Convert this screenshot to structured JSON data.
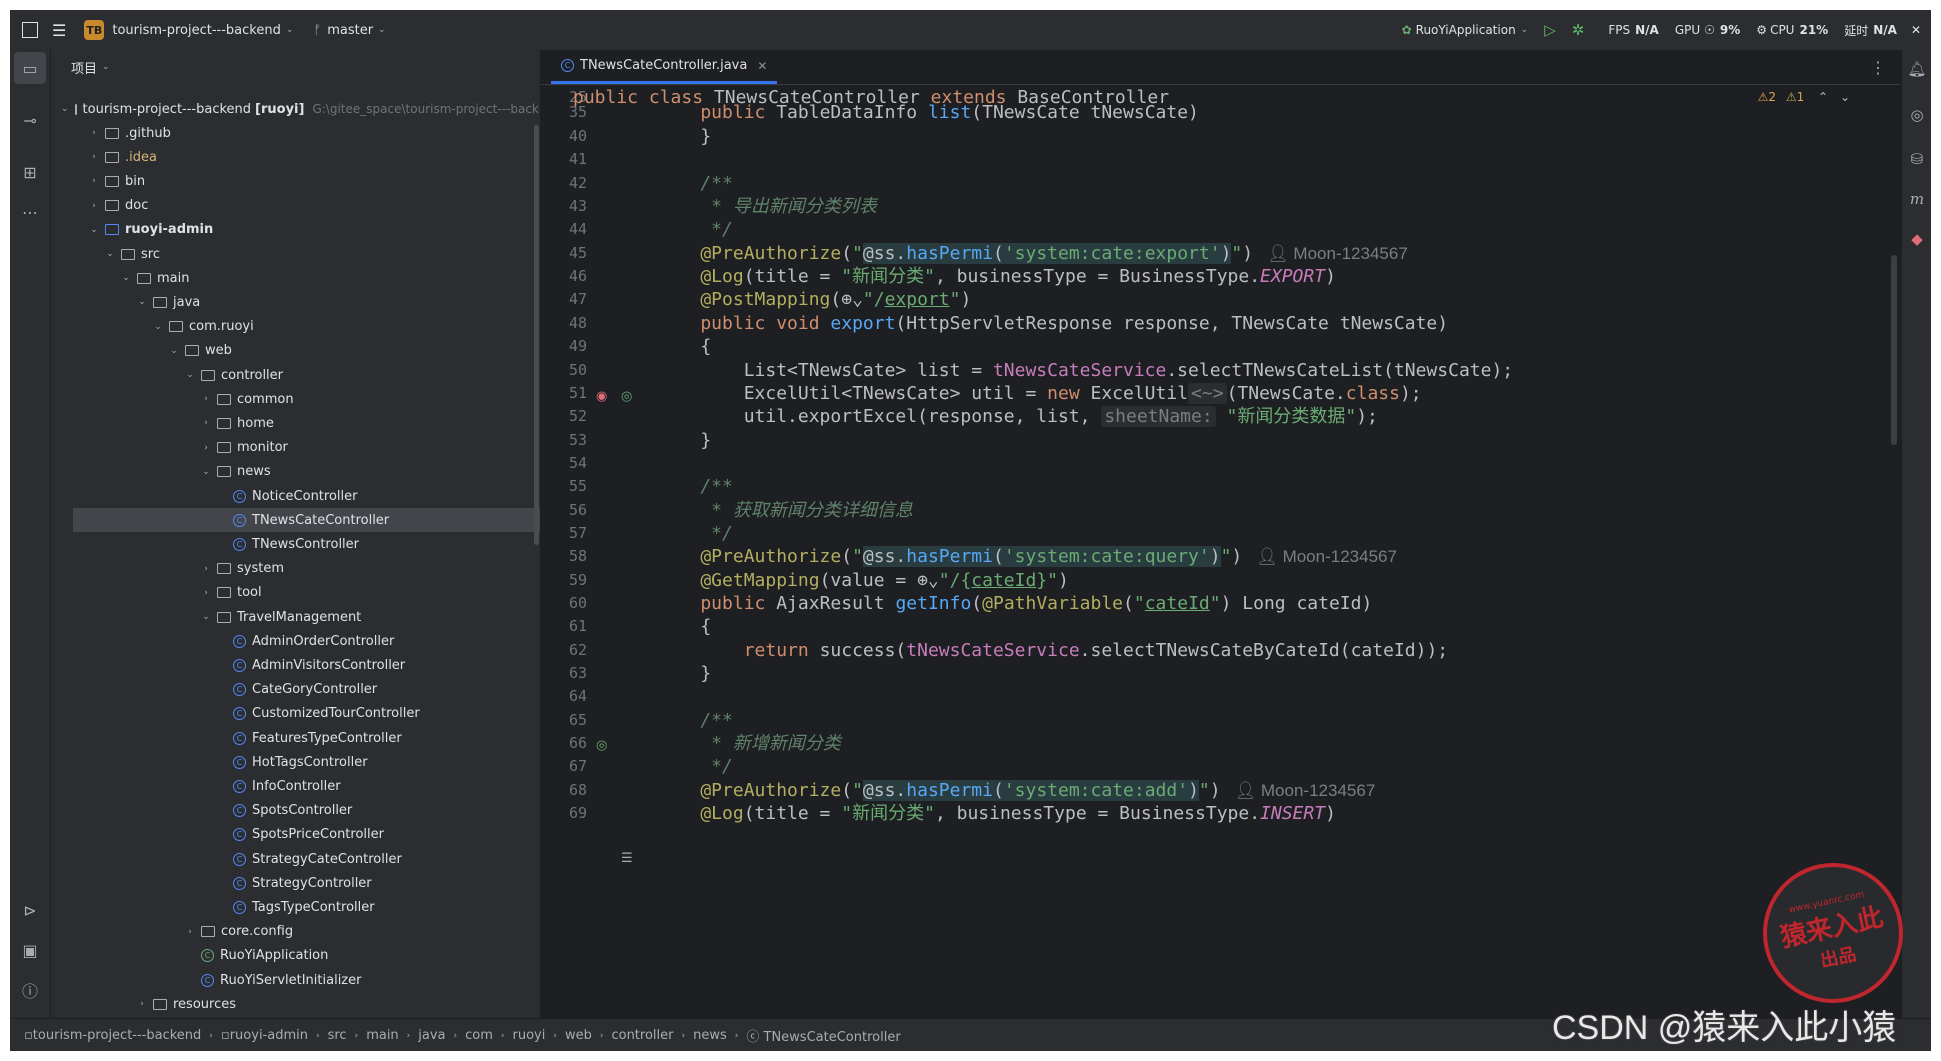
{
  "titlebar": {
    "project_badge": "TB",
    "project_name": "tourism-project---backend",
    "branch": "master",
    "run_config": "RuoYiApplication",
    "fps_label": "FPS",
    "fps_value": "N/A",
    "gpu_label": "GPU",
    "gpu_value": "9%",
    "cpu_label": "CPU",
    "cpu_value": "21%",
    "time_label": "延时",
    "time_value": "N/A"
  },
  "project_panel": {
    "header": "项目",
    "root_name": "tourism-project---backend",
    "root_module": "[ruoyi]",
    "root_path": "G:\\gitee_space\\tourism-project---back",
    "tree": [
      {
        "label": ".github",
        "depth": 1,
        "kind": "folder",
        "state": "collapsed"
      },
      {
        "label": ".idea",
        "depth": 1,
        "kind": "folder",
        "state": "collapsed",
        "style": "yellow"
      },
      {
        "label": "bin",
        "depth": 1,
        "kind": "folder",
        "state": "collapsed"
      },
      {
        "label": "doc",
        "depth": 1,
        "kind": "folder",
        "state": "collapsed"
      },
      {
        "label": "ruoyi-admin",
        "depth": 1,
        "kind": "module",
        "state": "expanded",
        "style": "bold"
      },
      {
        "label": "src",
        "depth": 2,
        "kind": "folder",
        "state": "expanded"
      },
      {
        "label": "main",
        "depth": 3,
        "kind": "folder",
        "state": "expanded"
      },
      {
        "label": "java",
        "depth": 4,
        "kind": "folder",
        "state": "expanded"
      },
      {
        "label": "com.ruoyi",
        "depth": 5,
        "kind": "package",
        "state": "expanded"
      },
      {
        "label": "web",
        "depth": 6,
        "kind": "package",
        "state": "expanded"
      },
      {
        "label": "controller",
        "depth": 7,
        "kind": "package",
        "state": "expanded"
      },
      {
        "label": "common",
        "depth": 8,
        "kind": "package",
        "state": "collapsed"
      },
      {
        "label": "home",
        "depth": 8,
        "kind": "package",
        "state": "collapsed"
      },
      {
        "label": "monitor",
        "depth": 8,
        "kind": "package",
        "state": "collapsed"
      },
      {
        "label": "news",
        "depth": 8,
        "kind": "package",
        "state": "expanded"
      },
      {
        "label": "NoticeController",
        "depth": 9,
        "kind": "class"
      },
      {
        "label": "TNewsCateController",
        "depth": 9,
        "kind": "class",
        "selected": true
      },
      {
        "label": "TNewsController",
        "depth": 9,
        "kind": "class"
      },
      {
        "label": "system",
        "depth": 8,
        "kind": "package",
        "state": "collapsed"
      },
      {
        "label": "tool",
        "depth": 8,
        "kind": "package",
        "state": "collapsed"
      },
      {
        "label": "TravelManagement",
        "depth": 8,
        "kind": "package",
        "state": "expanded"
      },
      {
        "label": "AdminOrderController",
        "depth": 9,
        "kind": "class"
      },
      {
        "label": "AdminVisitorsController",
        "depth": 9,
        "kind": "class"
      },
      {
        "label": "CateGoryController",
        "depth": 9,
        "kind": "class"
      },
      {
        "label": "CustomizedTourController",
        "depth": 9,
        "kind": "class"
      },
      {
        "label": "FeaturesTypeController",
        "depth": 9,
        "kind": "class"
      },
      {
        "label": "HotTagsController",
        "depth": 9,
        "kind": "class"
      },
      {
        "label": "InfoController",
        "depth": 9,
        "kind": "class"
      },
      {
        "label": "SpotsController",
        "depth": 9,
        "kind": "class"
      },
      {
        "label": "SpotsPriceController",
        "depth": 9,
        "kind": "class"
      },
      {
        "label": "StrategyCateController",
        "depth": 9,
        "kind": "class"
      },
      {
        "label": "StrategyController",
        "depth": 9,
        "kind": "class"
      },
      {
        "label": "TagsTypeController",
        "depth": 9,
        "kind": "class"
      },
      {
        "label": "core.config",
        "depth": 7,
        "kind": "package",
        "state": "collapsed"
      },
      {
        "label": "RuoYiApplication",
        "depth": 7,
        "kind": "app"
      },
      {
        "label": "RuoYiServletInitializer",
        "depth": 7,
        "kind": "class"
      },
      {
        "label": "resources",
        "depth": 4,
        "kind": "folder",
        "state": "collapsed"
      }
    ]
  },
  "editor": {
    "tab_label": "TNewsCateController.java",
    "warnings": "⚠2",
    "weak_warnings": "⚠1",
    "line_numbers": [
      "25",
      "35",
      "40",
      "41",
      "42",
      "43",
      "44",
      "45",
      "46",
      "47",
      "48",
      "49",
      "50",
      "51",
      "52",
      "53",
      "54",
      "55",
      "56",
      "57",
      "58",
      "59",
      "60",
      "61",
      "62",
      "63",
      "64",
      "65",
      "66",
      "67",
      "68",
      "69"
    ],
    "lines": [
      [
        [
          "kw",
          "public class "
        ],
        [
          "",
          "TNewsCateController "
        ],
        [
          "kw",
          "extends "
        ],
        [
          "",
          "BaseController"
        ]
      ],
      [
        [
          "kw",
          "    public "
        ],
        [
          "",
          "TableDataInfo "
        ],
        [
          "fn",
          "list"
        ],
        [
          "",
          "(TNewsCate tNewsCate)"
        ]
      ],
      [
        [
          "",
          "    }"
        ]
      ],
      [
        [
          "",
          ""
        ]
      ],
      [
        [
          "doc",
          "    /**"
        ]
      ],
      [
        [
          "doc",
          "     * 导出新闻分类列表"
        ]
      ],
      [
        [
          "doc",
          "     */"
        ]
      ],
      [
        [
          "ann",
          "    @PreAuthorize"
        ],
        [
          "",
          "("
        ],
        [
          "str",
          "\""
        ],
        [
          "inj",
          "@ss."
        ],
        [
          "fn inj",
          "hasPermi"
        ],
        [
          "inj",
          "("
        ],
        [
          "str inj",
          "'system:cate:export'"
        ],
        [
          "inj",
          ")"
        ],
        [
          "str",
          "\""
        ],
        [
          "",
          ")"
        ],
        [
          "author",
          "Moon-1234567"
        ]
      ],
      [
        [
          "ann",
          "    @Log"
        ],
        [
          "",
          "(title = "
        ],
        [
          "str",
          "\"新闻分类\""
        ],
        [
          "",
          ", businessType = BusinessType."
        ],
        [
          "itl",
          "EXPORT"
        ],
        [
          "",
          ")"
        ]
      ],
      [
        [
          "ann",
          "    @PostMapping"
        ],
        [
          "",
          "(⊕⌄"
        ],
        [
          "str",
          "\"/"
        ],
        [
          "str underline",
          "export"
        ],
        [
          "str",
          "\""
        ],
        [
          "",
          ")"
        ]
      ],
      [
        [
          "kw",
          "    public void "
        ],
        [
          "fn",
          "export"
        ],
        [
          "",
          "(HttpServletResponse response, TNewsCate tNewsCate)"
        ]
      ],
      [
        [
          "",
          "    {"
        ]
      ],
      [
        [
          "",
          "        List<TNewsCate> list = "
        ],
        [
          "fld",
          "tNewsCateService"
        ],
        [
          "",
          ".selectTNewsCateList(tNewsCate);"
        ]
      ],
      [
        [
          "",
          "        ExcelUtil<TNewsCate> util = "
        ],
        [
          "kw",
          "new "
        ],
        [
          "",
          "ExcelUtil"
        ],
        [
          "hint",
          "<~>"
        ],
        [
          "",
          "(TNewsCate."
        ],
        [
          "kw",
          "class"
        ],
        [
          "",
          ");"
        ]
      ],
      [
        [
          "",
          "        util.exportExcel(response, list, "
        ],
        [
          "hint",
          "sheetName:"
        ],
        [
          "str",
          " \"新闻分类数据\""
        ],
        [
          "",
          ");"
        ]
      ],
      [
        [
          "",
          "    }"
        ]
      ],
      [
        [
          "",
          ""
        ]
      ],
      [
        [
          "doc",
          "    /**"
        ]
      ],
      [
        [
          "doc",
          "     * 获取新闻分类详细信息"
        ]
      ],
      [
        [
          "doc",
          "     */"
        ]
      ],
      [
        [
          "ann",
          "    @PreAuthorize"
        ],
        [
          "",
          "("
        ],
        [
          "str",
          "\""
        ],
        [
          "inj",
          "@ss."
        ],
        [
          "fn inj",
          "hasPermi"
        ],
        [
          "inj",
          "("
        ],
        [
          "str inj",
          "'system:cate:query'"
        ],
        [
          "inj",
          ")"
        ],
        [
          "str",
          "\""
        ],
        [
          "",
          ")"
        ],
        [
          "author",
          "Moon-1234567"
        ]
      ],
      [
        [
          "ann",
          "    @GetMapping"
        ],
        [
          "",
          "(value = ⊕⌄"
        ],
        [
          "str",
          "\"/{"
        ],
        [
          "str underline",
          "cateId"
        ],
        [
          "str",
          "}\""
        ],
        [
          "",
          ")"
        ]
      ],
      [
        [
          "kw",
          "    public "
        ],
        [
          "",
          "AjaxResult "
        ],
        [
          "fn",
          "getInfo"
        ],
        [
          "",
          "("
        ],
        [
          "ann",
          "@PathVariable"
        ],
        [
          "",
          "("
        ],
        [
          "str",
          "\""
        ],
        [
          "str underline",
          "cateId"
        ],
        [
          "str",
          "\""
        ],
        [
          "",
          ") Long cateId)"
        ]
      ],
      [
        [
          "",
          "    {"
        ]
      ],
      [
        [
          "kw",
          "        return "
        ],
        [
          "",
          "success("
        ],
        [
          "fld",
          "tNewsCateService"
        ],
        [
          "",
          ".selectTNewsCateByCateId(cateId));"
        ]
      ],
      [
        [
          "",
          "    }"
        ]
      ],
      [
        [
          "",
          ""
        ]
      ],
      [
        [
          "doc",
          "    /**"
        ]
      ],
      [
        [
          "doc",
          "     * 新增新闻分类"
        ]
      ],
      [
        [
          "doc",
          "     */"
        ]
      ],
      [
        [
          "ann",
          "    @PreAuthorize"
        ],
        [
          "",
          "("
        ],
        [
          "str",
          "\""
        ],
        [
          "inj",
          "@ss."
        ],
        [
          "fn inj",
          "hasPermi"
        ],
        [
          "inj",
          "("
        ],
        [
          "str inj",
          "'system:cate:add'"
        ],
        [
          "inj",
          ")"
        ],
        [
          "str",
          "\""
        ],
        [
          "",
          ")"
        ],
        [
          "author",
          "Moon-1234567"
        ]
      ],
      [
        [
          "ann",
          "    @Log"
        ],
        [
          "",
          "(title = "
        ],
        [
          "str",
          "\"新闻分类\""
        ],
        [
          "",
          ", businessType = BusinessType."
        ],
        [
          "itl",
          "INSERT"
        ],
        [
          "",
          ")"
        ]
      ]
    ]
  },
  "statusbar": {
    "crumbs": [
      "tourism-project---backend",
      "ruoyi-admin",
      "src",
      "main",
      "java",
      "com",
      "ruoyi",
      "web",
      "controller",
      "news",
      "TNewsCateController"
    ]
  },
  "overlay": {
    "watermark": "CSDN @猿来入此小猿",
    "stamp_url": "www.yuanrc.com",
    "stamp_main": "猿来入此",
    "stamp_sub": "出品"
  }
}
